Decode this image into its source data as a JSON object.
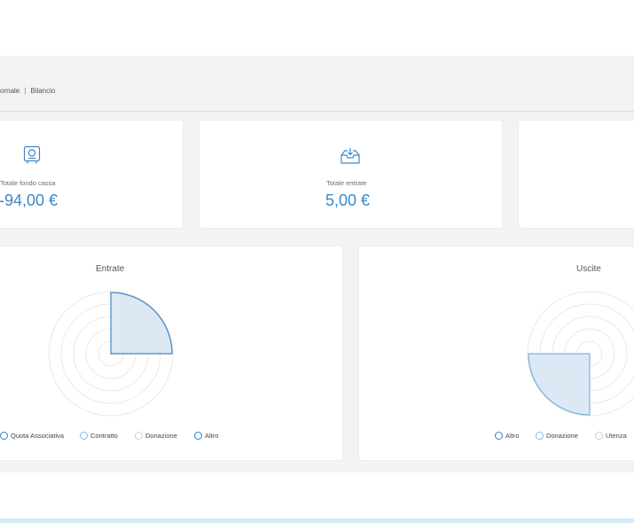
{
  "breadcrumb": {
    "item1": "ornale",
    "separator": "|",
    "item2": "Bilancio"
  },
  "stats": [
    {
      "icon": "safe-icon",
      "label": "Totale fondo cassa",
      "value": "-94,00 €"
    },
    {
      "icon": "inbox-download-icon",
      "label": "Totale entrate",
      "value": "5,00 €"
    }
  ],
  "charts": {
    "entrate": {
      "title": "Entrate",
      "legend": [
        "Quota Associativa",
        "Contratto",
        "Donazione",
        "Altro"
      ]
    },
    "uscite": {
      "title": "Uscite",
      "legend": [
        "Altro",
        "Donazione",
        "Utenza"
      ]
    }
  },
  "colors": {
    "accent": "#3d88c6",
    "background": "#f3f3f3",
    "slice_fill": "#dce8f3"
  }
}
